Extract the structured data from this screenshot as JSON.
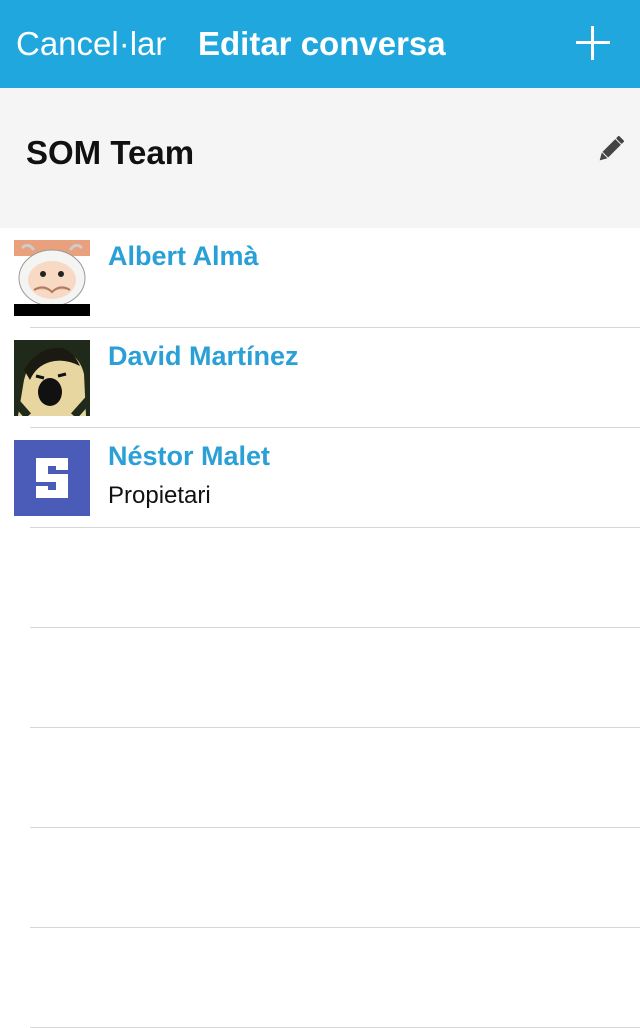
{
  "navbar": {
    "cancel_label": "Cancel·lar",
    "title": "Editar conversa",
    "add_icon": "plus-icon",
    "background": "#1fa7de"
  },
  "conversation": {
    "name": "SOM Team",
    "edit_icon": "pencil-icon"
  },
  "members": [
    {
      "name": "Albert Almà",
      "role": "",
      "avatar": "cartoon-avatar"
    },
    {
      "name": "David Martínez",
      "role": "",
      "avatar": "photo-avatar"
    },
    {
      "name": "Néstor Malet",
      "role": "Propietari",
      "avatar": "letter-s-avatar"
    }
  ],
  "colors": {
    "accent": "#2aa0d6",
    "header_panel": "#f5f5f5",
    "separator": "#d6d6d6"
  }
}
